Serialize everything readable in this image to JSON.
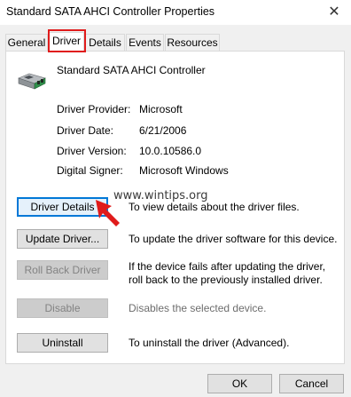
{
  "window": {
    "title": "Standard SATA AHCI Controller Properties",
    "close_glyph": "✕"
  },
  "tabs": [
    {
      "label": "General"
    },
    {
      "label": "Driver"
    },
    {
      "label": "Details"
    },
    {
      "label": "Events"
    },
    {
      "label": "Resources"
    }
  ],
  "active_tab": "Driver",
  "device": {
    "icon": "controller-chip-icon",
    "name": "Standard SATA AHCI Controller"
  },
  "info": [
    {
      "label": "Driver Provider:",
      "value": "Microsoft"
    },
    {
      "label": "Driver Date:",
      "value": "6/21/2006"
    },
    {
      "label": "Driver Version:",
      "value": "10.0.10586.0"
    },
    {
      "label": "Digital Signer:",
      "value": "Microsoft Windows"
    }
  ],
  "actions": [
    {
      "label": "Driver Details",
      "description": "To view details about the driver files.",
      "enabled": true
    },
    {
      "label": "Update Driver...",
      "description": "To update the driver software for this device.",
      "enabled": true
    },
    {
      "label": "Roll Back Driver",
      "description": "If the device fails after updating the driver, roll back to the previously installed driver.",
      "enabled": false
    },
    {
      "label": "Disable",
      "description": "Disables the selected device.",
      "enabled": false
    },
    {
      "label": "Uninstall",
      "description": "To uninstall the driver (Advanced).",
      "enabled": true
    }
  ],
  "watermark": "www.wintips.org",
  "footer": {
    "ok_label": "OK",
    "cancel_label": "Cancel"
  },
  "colors": {
    "highlight": "#e01b1b",
    "focus_border": "#0078d7"
  }
}
